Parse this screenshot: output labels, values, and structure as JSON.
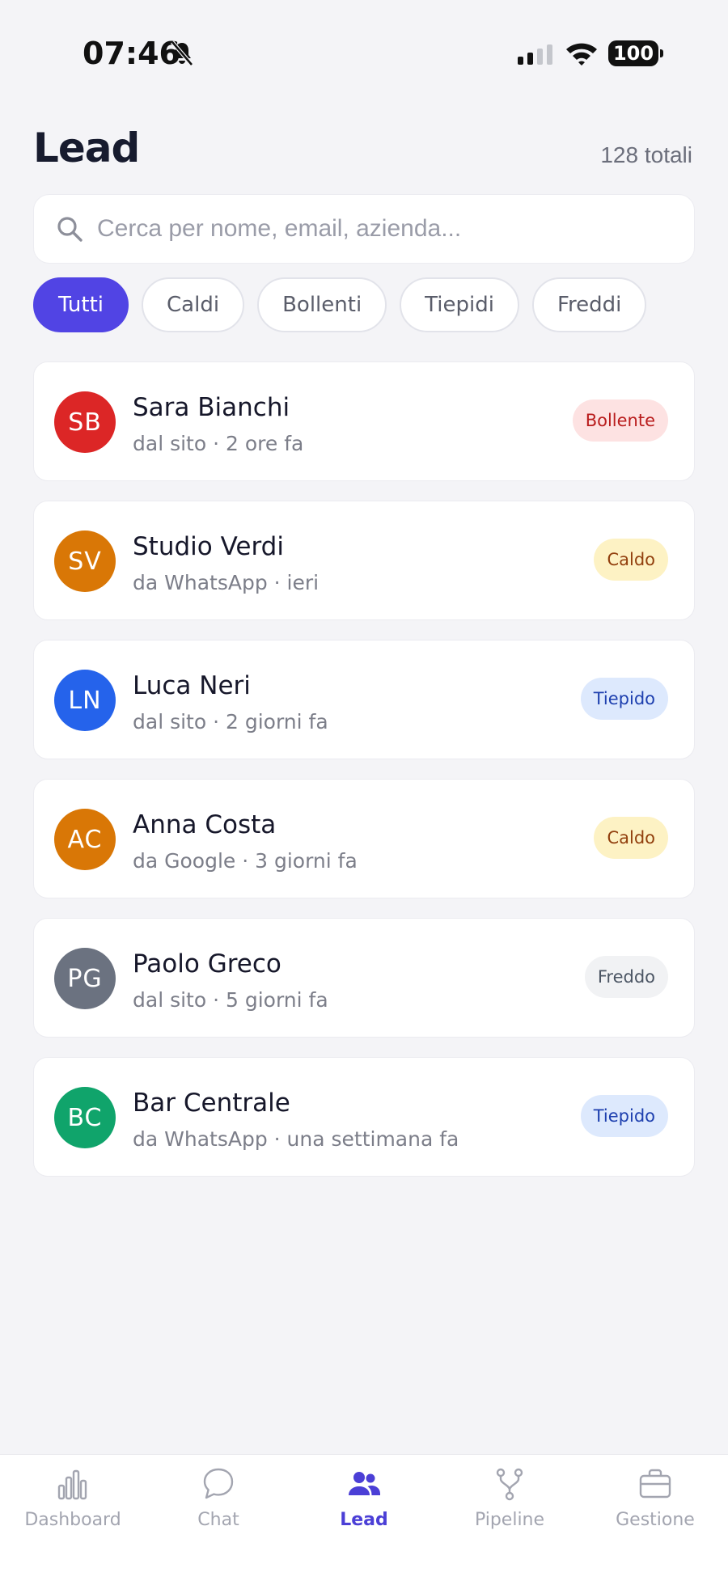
{
  "status_bar": {
    "time": "07:46",
    "battery": "100"
  },
  "header": {
    "title": "Lead",
    "total": "128 totali"
  },
  "search": {
    "placeholder": "Cerca per nome, email, azienda...",
    "value": ""
  },
  "filters": [
    {
      "label": "Tutti",
      "active": true
    },
    {
      "label": "Caldi",
      "active": false
    },
    {
      "label": "Bollenti",
      "active": false
    },
    {
      "label": "Tiepidi",
      "active": false
    },
    {
      "label": "Freddi",
      "active": false
    }
  ],
  "leads": [
    {
      "initials": "SB",
      "name": "Sara Bianchi",
      "meta": "dal sito · 2 ore fa",
      "status": "Bollente",
      "avatar_color": "#dc2626",
      "badge_bg": "#fde2e2",
      "badge_fg": "#b91c1c"
    },
    {
      "initials": "SV",
      "name": "Studio Verdi",
      "meta": "da WhatsApp · ieri",
      "status": "Caldo",
      "avatar_color": "#d97706",
      "badge_bg": "#fdf2c4",
      "badge_fg": "#92400e"
    },
    {
      "initials": "LN",
      "name": "Luca Neri",
      "meta": "dal sito · 2 giorni fa",
      "status": "Tiepido",
      "avatar_color": "#2563eb",
      "badge_bg": "#dde9fd",
      "badge_fg": "#1e40af"
    },
    {
      "initials": "AC",
      "name": "Anna Costa",
      "meta": "da Google · 3 giorni fa",
      "status": "Caldo",
      "avatar_color": "#d97706",
      "badge_bg": "#fdf2c4",
      "badge_fg": "#92400e"
    },
    {
      "initials": "PG",
      "name": "Paolo Greco",
      "meta": "dal sito · 5 giorni fa",
      "status": "Freddo",
      "avatar_color": "#6b7280",
      "badge_bg": "#f1f2f4",
      "badge_fg": "#4b5563"
    },
    {
      "initials": "BC",
      "name": "Bar Centrale",
      "meta": "da WhatsApp · una settimana fa",
      "status": "Tiepido",
      "avatar_color": "#10a46b",
      "badge_bg": "#dde9fd",
      "badge_fg": "#1e40af"
    }
  ],
  "tab_bar": [
    {
      "label": "Dashboard",
      "icon": "bar-chart-icon",
      "active": false
    },
    {
      "label": "Chat",
      "icon": "chat-bubble-icon",
      "active": false
    },
    {
      "label": "Lead",
      "icon": "users-icon",
      "active": true
    },
    {
      "label": "Pipeline",
      "icon": "branch-icon",
      "active": false
    },
    {
      "label": "Gestione",
      "icon": "briefcase-icon",
      "active": false
    }
  ],
  "colors": {
    "accent": "#5144e4",
    "background": "#f4f4f7"
  }
}
